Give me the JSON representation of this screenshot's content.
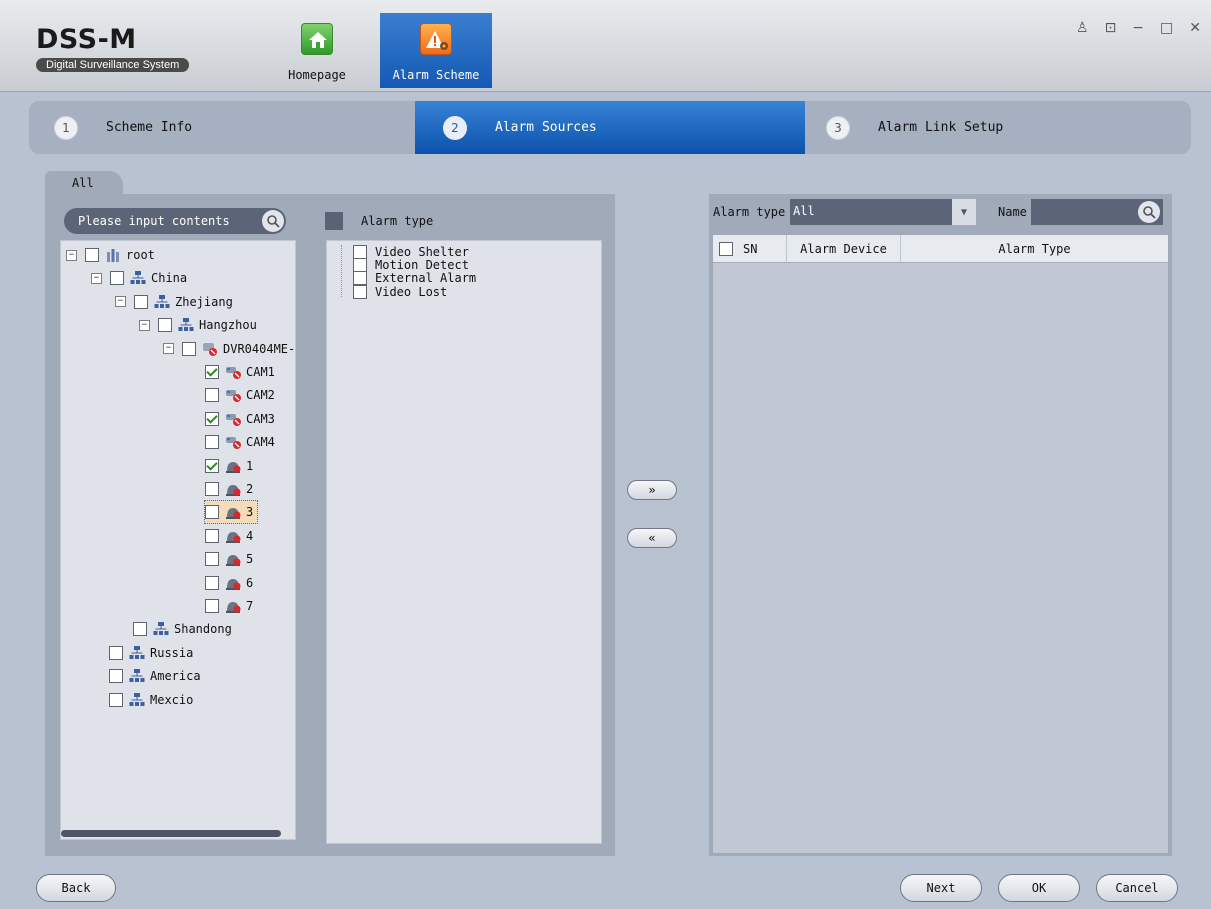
{
  "app": {
    "title": "DSS-M",
    "subtitle": "Digital Surveillance System"
  },
  "nav": {
    "homepage": "Homepage",
    "alarm_scheme": "Alarm Scheme"
  },
  "window_controls": {
    "user": "♙",
    "lock": "⊡",
    "minimize": "−",
    "maximize": "□",
    "close": "✕"
  },
  "steps": [
    {
      "num": "1",
      "label": "Scheme Info"
    },
    {
      "num": "2",
      "label": "Alarm Sources"
    },
    {
      "num": "3",
      "label": "Alarm Link Setup"
    }
  ],
  "left": {
    "tab": "All",
    "search_placeholder": "Please input contents"
  },
  "tree": [
    {
      "label": "root",
      "icon": "root-icon",
      "checked": false,
      "expander": "⊟"
    },
    {
      "label": "China",
      "icon": "org-icon",
      "checked": false,
      "expander": "⊟"
    },
    {
      "label": "Zhejiang",
      "icon": "org-icon",
      "checked": false,
      "expander": "⊟"
    },
    {
      "label": "Hangzhou",
      "icon": "org-icon",
      "checked": false,
      "expander": "⊟"
    },
    {
      "label": "DVR0404ME-",
      "icon": "dvr-icon",
      "checked": false,
      "expander": "⊟"
    },
    {
      "label": "CAM1",
      "icon": "camera-icon",
      "checked": true
    },
    {
      "label": "CAM2",
      "icon": "camera-icon",
      "checked": false
    },
    {
      "label": "CAM3",
      "icon": "camera-icon",
      "checked": true
    },
    {
      "label": "CAM4",
      "icon": "camera-icon",
      "checked": false
    },
    {
      "label": "1",
      "icon": "alarm-input-icon",
      "checked": true
    },
    {
      "label": "2",
      "icon": "alarm-input-icon",
      "checked": false
    },
    {
      "label": "3",
      "icon": "alarm-input-icon",
      "checked": false,
      "selected": true
    },
    {
      "label": "4",
      "icon": "alarm-input-icon",
      "checked": false
    },
    {
      "label": "5",
      "icon": "alarm-input-icon",
      "checked": false
    },
    {
      "label": "6",
      "icon": "alarm-input-icon",
      "checked": false
    },
    {
      "label": "7",
      "icon": "alarm-input-icon",
      "checked": false
    },
    {
      "label": "Shandong",
      "icon": "org-icon",
      "checked": false
    },
    {
      "label": "Russia",
      "icon": "org-icon",
      "checked": false
    },
    {
      "label": "America",
      "icon": "org-icon",
      "checked": false
    },
    {
      "label": "Mexcio",
      "icon": "org-icon",
      "checked": false
    }
  ],
  "alarm_type": {
    "header": "Alarm type",
    "items": [
      "Video Shelter",
      "Motion Detect",
      "External Alarm",
      "Video Lost"
    ]
  },
  "move": {
    "add": "»",
    "remove": "«"
  },
  "right": {
    "filter_label": "Alarm type",
    "filter_value": "All",
    "name_label": "Name",
    "columns": [
      "SN",
      "Alarm Device",
      "Alarm Type"
    ]
  },
  "footer": {
    "back": "Back",
    "next": "Next",
    "ok": "OK",
    "cancel": "Cancel"
  },
  "colors": {
    "active_blue": "#1459b4",
    "panel": "#a0aab9",
    "accent_check": "#2a8a1f"
  }
}
